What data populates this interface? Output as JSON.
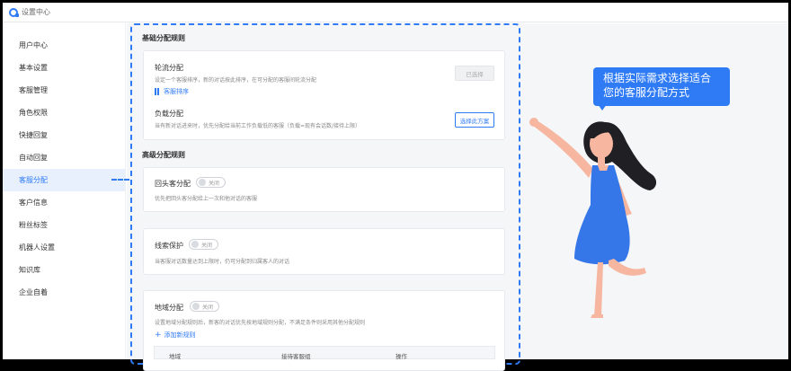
{
  "window": {
    "title": "设置中心"
  },
  "sidebar": {
    "items": [
      {
        "label": "用户中心",
        "active": false
      },
      {
        "label": "基本设置",
        "active": false
      },
      {
        "label": "客服管理",
        "active": false
      },
      {
        "label": "角色权限",
        "active": false
      },
      {
        "label": "快捷回复",
        "active": false
      },
      {
        "label": "自动回复",
        "active": false
      },
      {
        "label": "客服分配",
        "active": true
      },
      {
        "label": "客户信息",
        "active": false
      },
      {
        "label": "粉丝标签",
        "active": false
      },
      {
        "label": "机器人设置",
        "active": false
      },
      {
        "label": "知识库",
        "active": false
      },
      {
        "label": "企业自着",
        "active": false
      }
    ]
  },
  "basic": {
    "section_title": "基础分配规则",
    "round_robin": {
      "title": "轮流分配",
      "desc": "设定一个客服排序，新的对话按此排序，在可分配的客服间轮流分配",
      "link": "客服排序",
      "button": "已选择"
    },
    "load": {
      "title": "负载分配",
      "desc": "当有新对话进来时，优先分配给当前工作负载低的客服（负载=现有会话数/接待上限）",
      "button": "选择此方案"
    }
  },
  "advanced": {
    "section_title": "高级分配规则",
    "returning": {
      "title": "回头客分配",
      "toggle": "关闭",
      "desc": "优先把回头客分配给上一次和他对话的客服"
    },
    "lead": {
      "title": "线索保护",
      "toggle": "关闭",
      "desc": "当客服对话数量达到上限时，仍可分配到归属客人的对话"
    },
    "region": {
      "title": "地域分配",
      "toggle": "关闭",
      "desc": "设置地域分配规则后，新客的对话优先按地域规则分配，不满足条件则采用其他分配规则",
      "add_link": "添加新规则",
      "table_headers": [
        "地域",
        "接待客服组",
        "操作"
      ]
    }
  },
  "callout": {
    "line1": "根据实际需求选择适合",
    "line2": "您的客服分配方式"
  },
  "colors": {
    "accent": "#2f7bf6",
    "dress": "#3576e8"
  }
}
